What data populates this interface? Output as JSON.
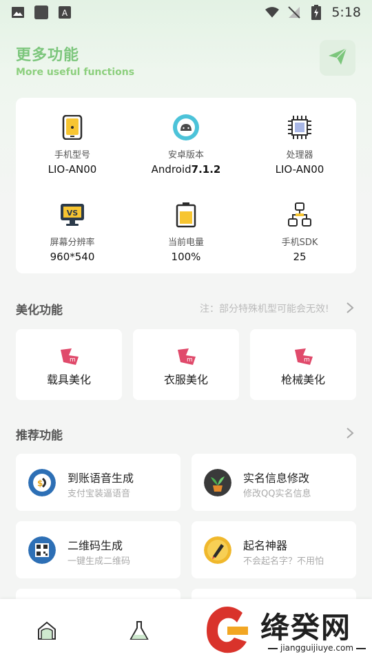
{
  "status_bar": {
    "time": "5:18"
  },
  "header": {
    "title": "更多功能",
    "subtitle": "More useful functions"
  },
  "device_info": [
    {
      "label": "手机型号",
      "value": "LIO-AN00",
      "icon": "phone-icon"
    },
    {
      "label": "安卓版本",
      "value": "Android",
      "value_bold": "7.1.2",
      "icon": "android-icon"
    },
    {
      "label": "处理器",
      "value": "LIO-AN00",
      "icon": "cpu-icon"
    },
    {
      "label": "屏幕分辨率",
      "value": "960*540",
      "icon": "monitor-icon"
    },
    {
      "label": "当前电量",
      "value": "100%",
      "icon": "battery-icon"
    },
    {
      "label": "手机SDK",
      "value": "25",
      "icon": "network-icon"
    }
  ],
  "beautify": {
    "title": "美化功能",
    "note": "注：部分特殊机型可能会无效!",
    "items": [
      {
        "label": "载具美化"
      },
      {
        "label": "衣服美化"
      },
      {
        "label": "枪械美化"
      }
    ]
  },
  "recommend": {
    "title": "推荐功能",
    "items": [
      {
        "title": "到账语音生成",
        "subtitle": "支付宝装逼语音",
        "icon": "money-voice-icon"
      },
      {
        "title": "实名信息修改",
        "subtitle": "修改QQ实名信息",
        "icon": "plant-icon"
      },
      {
        "title": "二维码生成",
        "subtitle": "一键生成二维码",
        "icon": "qr-code-icon"
      },
      {
        "title": "起名神器",
        "subtitle": "不会起名字？不用怕",
        "icon": "pen-icon"
      }
    ]
  },
  "bottom_nav": [
    {
      "name": "home",
      "icon": "home-icon"
    },
    {
      "name": "lab",
      "icon": "flask-icon"
    }
  ],
  "watermark": {
    "text": "绛癸网",
    "url": "jiangguijiuye.com"
  },
  "colors": {
    "accent": "#7cc67c",
    "accent_light": "#e1efe1",
    "pink": "#e04a6b"
  }
}
